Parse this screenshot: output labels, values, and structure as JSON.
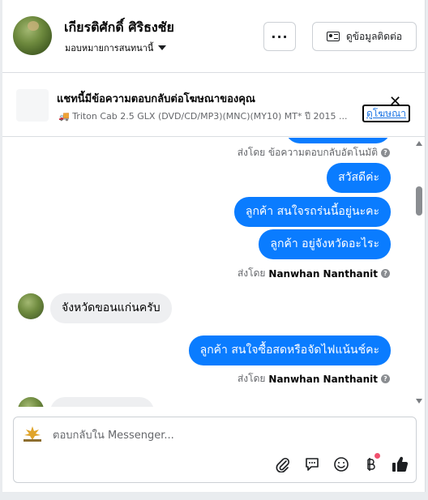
{
  "header": {
    "contact_name": "เกียรติศักดิ์ ศิริธงชัย",
    "assign_label": "มอบหมายการสนทนานี้",
    "more_label": "···",
    "contact_info_label": "ดูข้อมูลติดต่อ"
  },
  "ad_banner": {
    "title": "แชทนี้มีข้อความตอบกลับต่อโฆษณาของคุณ",
    "subtitle": "🚚 Triton Cab 2.5 GLX (DVD/CD/MP3)(MNC)(MY10) MT* ปี 2015 ...",
    "view_ad_label": "ดูโฆษณา",
    "close_label": "✕"
  },
  "messages": {
    "auto_reply_note": "ส่งโดย ข้อความตอบกลับอัตโนมัติ",
    "out_1": "สวัสดีค่ะ",
    "out_2": "ลูกค้า สนใจรถร่นนี้อยู่นะคะ",
    "out_3": "ลูกค้า  อยู่จังหวัดอะไระ",
    "sent_by_prefix": "ส่งโดย",
    "sender_name": "Nanwhan Nanthanit",
    "in_1": "จังหวัดขอนแก่นครับ",
    "out_4": "ลูกค้า สนใจซื้อสดหรือจัดไฟแน้นช์คะ"
  },
  "composer": {
    "placeholder": "ตอบกลับใน Messenger..."
  },
  "colors": {
    "outgoing_bubble": "#0a7cff",
    "incoming_bubble": "#eeeff1",
    "like_icon": "#1c1e21",
    "notification_dot": "#f0506e"
  },
  "icons": [
    "chevron-down-icon",
    "id-card-icon",
    "close-icon",
    "help-icon",
    "paperclip-icon",
    "saved-reply-icon",
    "emoji-icon",
    "baht-icon",
    "thumbs-up-icon"
  ]
}
